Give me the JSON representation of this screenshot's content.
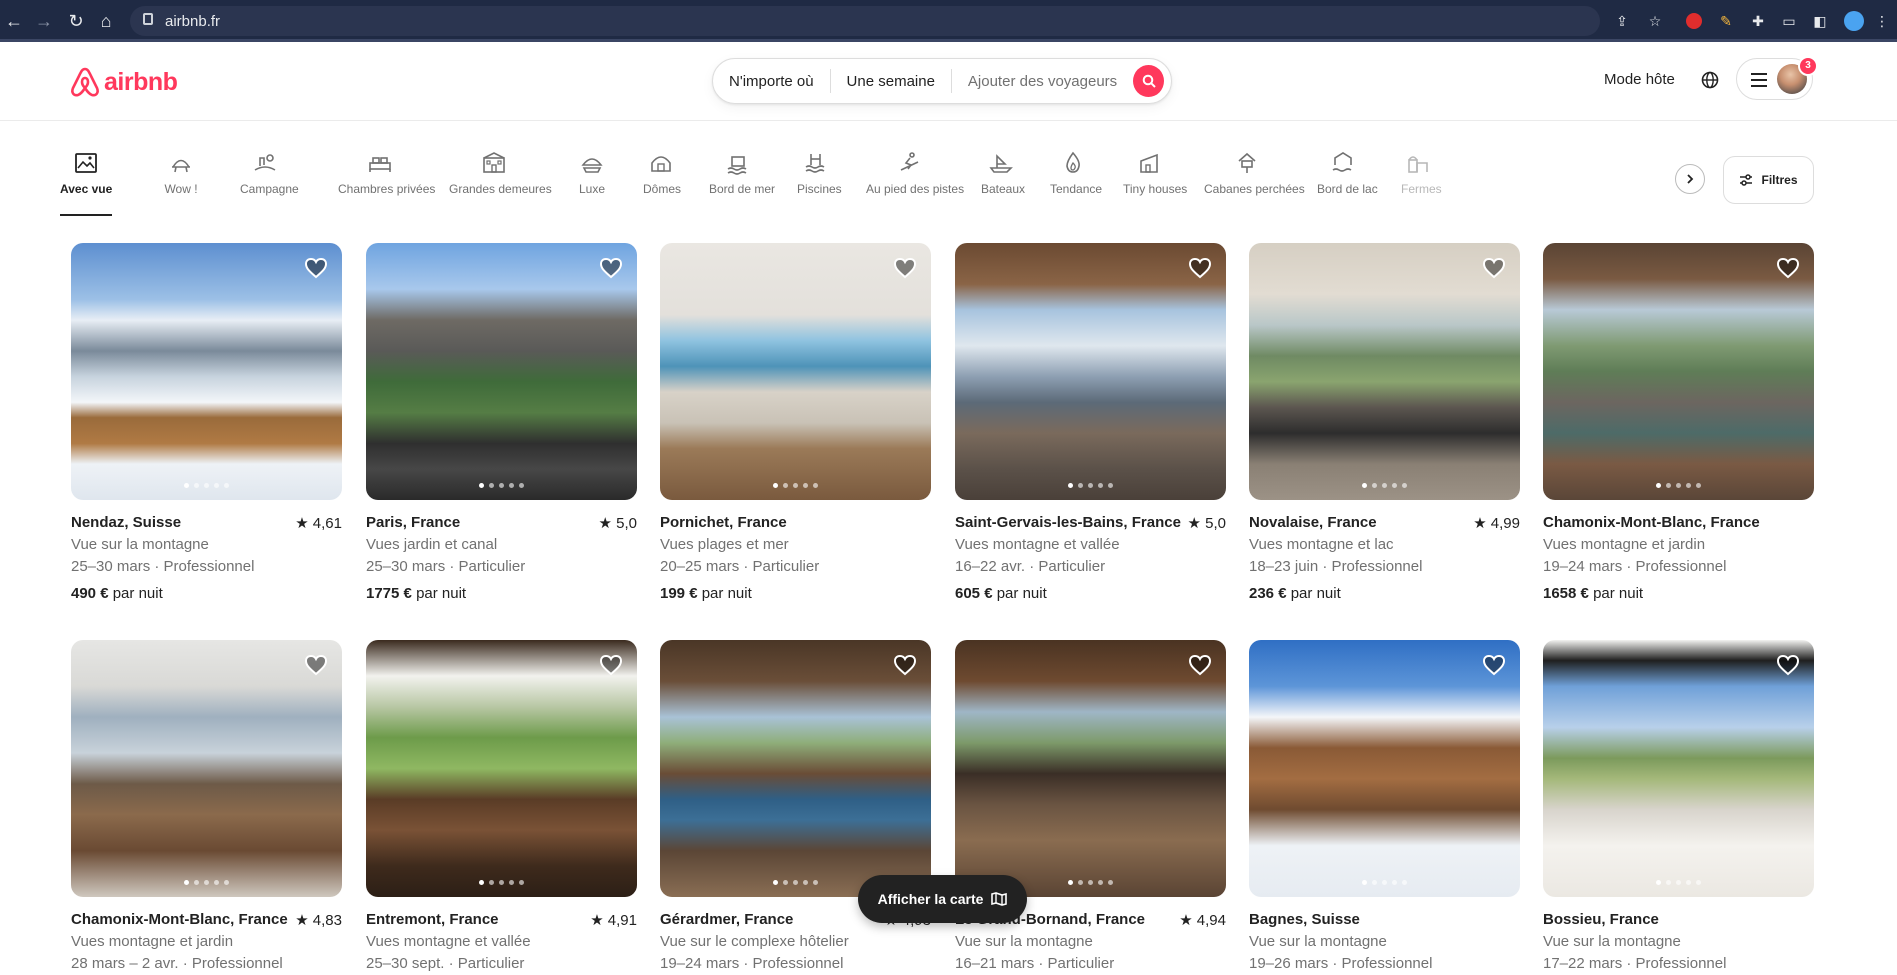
{
  "browser": {
    "url": "airbnb.fr"
  },
  "header": {
    "logo_text": "airbnb",
    "search": {
      "where": "N'importe où",
      "when": "Une semaine",
      "guests": "Ajouter des voyageurs"
    },
    "host_mode": "Mode hôte",
    "notifications": "3"
  },
  "categories": [
    {
      "label": "Avec vue",
      "icon": "view-icon",
      "active": true
    },
    {
      "label": "Wow !",
      "icon": "wow-icon"
    },
    {
      "label": "Campagne",
      "icon": "countryside-icon"
    },
    {
      "label": "Chambres privées",
      "icon": "private-room-icon"
    },
    {
      "label": "Grandes demeures",
      "icon": "mansion-icon"
    },
    {
      "label": "Luxe",
      "icon": "luxe-icon"
    },
    {
      "label": "Dômes",
      "icon": "dome-icon"
    },
    {
      "label": "Bord de mer",
      "icon": "beachfront-icon"
    },
    {
      "label": "Piscines",
      "icon": "pool-icon"
    },
    {
      "label": "Au pied des pistes",
      "icon": "ski-icon"
    },
    {
      "label": "Bateaux",
      "icon": "boat-icon"
    },
    {
      "label": "Tendance",
      "icon": "flame-icon"
    },
    {
      "label": "Tiny houses",
      "icon": "tiny-house-icon"
    },
    {
      "label": "Cabanes perchées",
      "icon": "treehouse-icon"
    },
    {
      "label": "Bord de lac",
      "icon": "lake-icon"
    },
    {
      "label": "Fermes",
      "icon": "farm-icon"
    }
  ],
  "filters_label": "Filtres",
  "map_button": "Afficher la carte",
  "listings": [
    {
      "location": "Nendaz, Suisse",
      "rating": "★ 4,61",
      "view": "Vue sur la montagne",
      "dates": "25–30 mars · Professionnel",
      "price": "490 €",
      "per": "par nuit",
      "photo": "alpine chalet in snow"
    },
    {
      "location": "Paris, France",
      "rating": "★ 5,0",
      "view": "Vues jardin et canal",
      "dates": "25–30 mars · Particulier",
      "price": "1775 €",
      "per": "par nuit",
      "photo": "eiffel tower balcony"
    },
    {
      "location": "Pornichet, France",
      "rating": "",
      "view": "Vues plages et mer",
      "dates": "20–25 mars · Particulier",
      "price": "199 €",
      "per": "par nuit",
      "photo": "sea view living room"
    },
    {
      "location": "Saint-Gervais-les-Bains, France",
      "rating": "★ 5,0",
      "view": "Vues montagne et vallée",
      "dates": "16–22 avr. · Particulier",
      "price": "605 €",
      "per": "par nuit",
      "photo": "wooden chalet mountain view"
    },
    {
      "location": "Novalaise, France",
      "rating": "★ 4,99",
      "view": "Vues montagne et lac",
      "dates": "18–23 juin · Professionnel",
      "price": "236 €",
      "per": "par nuit",
      "photo": "veranda lake view"
    },
    {
      "location": "Chamonix-Mont-Blanc, France",
      "rating": "",
      "view": "Vues montagne et jardin",
      "dates": "19–24 mars · Professionnel",
      "price": "1658 €",
      "per": "par nuit",
      "photo": "loft mountain view"
    },
    {
      "location": "Chamonix-Mont-Blanc, France",
      "rating": "★ 4,83",
      "view": "Vues montagne et jardin",
      "dates": "28 mars – 2 avr. · Professionnel",
      "price": "",
      "per": "",
      "photo": "dining room windows"
    },
    {
      "location": "Entremont, France",
      "rating": "★ 4,91",
      "view": "Vues montagne et vallée",
      "dates": "25–30 sept. · Particulier",
      "price": "",
      "per": "",
      "photo": "breakfast balcony valley"
    },
    {
      "location": "Gérardmer, France",
      "rating": "★ 4,93",
      "view": "Vue sur le complexe hôtelier",
      "dates": "19–24 mars · Professionnel",
      "price": "",
      "per": "",
      "photo": "chalet lounge blue sofa"
    },
    {
      "location": "Le Grand-Bornand, France",
      "rating": "★ 4,94",
      "view": "Vue sur la montagne",
      "dates": "16–21 mars · Particulier",
      "price": "",
      "per": "",
      "photo": "chalet lounge tv"
    },
    {
      "location": "Bagnes, Suisse",
      "rating": "",
      "view": "Vue sur la montagne",
      "dates": "19–26 mars · Professionnel",
      "price": "",
      "per": "",
      "photo": "snowy chalet exterior"
    },
    {
      "location": "Bossieu, France",
      "rating": "",
      "view": "Vue sur la montagne",
      "dates": "17–22 mars · Professionnel",
      "price": "",
      "per": "",
      "photo": "terrace countryside view"
    }
  ],
  "colors": {
    "brand": "#ff385c",
    "text": "#222222",
    "muted": "#717171"
  }
}
